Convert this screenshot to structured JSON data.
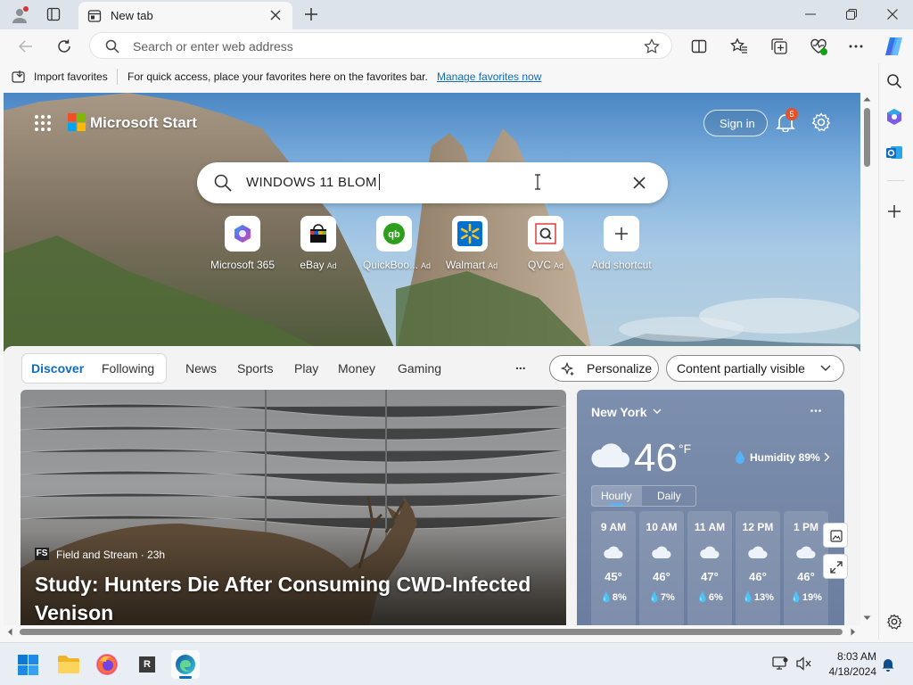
{
  "browser": {
    "tab_title": "New tab",
    "address_placeholder": "Search or enter web address"
  },
  "favorites_bar": {
    "import_label": "Import favorites",
    "hint": "For quick access, place your favorites here on the favorites bar.",
    "manage_link": "Manage favorites now"
  },
  "msn": {
    "brand": "Microsoft Start",
    "sign_in": "Sign in",
    "notification_count": "5",
    "search_value": "WINDOWS 11 BLOM",
    "shortcuts": [
      {
        "label": "Microsoft 365",
        "ad": ""
      },
      {
        "label": "eBay",
        "ad": "Ad"
      },
      {
        "label": "QuickBoo...",
        "ad": "Ad"
      },
      {
        "label": "Walmart",
        "ad": "Ad"
      },
      {
        "label": "QVC",
        "ad": "Ad"
      },
      {
        "label": "Add shortcut",
        "ad": ""
      }
    ]
  },
  "feed": {
    "tabs": [
      "Discover",
      "Following",
      "News",
      "Sports",
      "Play",
      "Money",
      "Gaming"
    ],
    "more": "...",
    "personalize": "Personalize",
    "content_visibility": "Content partially visible",
    "article": {
      "source_badge": "FS",
      "source": "Field and Stream · 23h",
      "headline": "Study: Hunters Die After Consuming CWD-Infected Venison"
    },
    "weather": {
      "location": "New York",
      "temperature": "46",
      "unit": "°F",
      "humidity": "Humidity 89%",
      "modes": [
        "Hourly",
        "Daily"
      ],
      "hours": [
        {
          "time": "9 AM",
          "temp": "45°",
          "precip": "8%"
        },
        {
          "time": "10 AM",
          "temp": "46°",
          "precip": "7%"
        },
        {
          "time": "11 AM",
          "temp": "47°",
          "precip": "6%"
        },
        {
          "time": "12 PM",
          "temp": "46°",
          "precip": "13%"
        },
        {
          "time": "1 PM",
          "temp": "46°",
          "precip": "19%"
        }
      ]
    }
  },
  "taskbar": {
    "time": "8:03 AM",
    "date": "4/18/2024"
  },
  "colors": {
    "accent": "#0f6cbd",
    "notification_badge": "#e5522a"
  }
}
